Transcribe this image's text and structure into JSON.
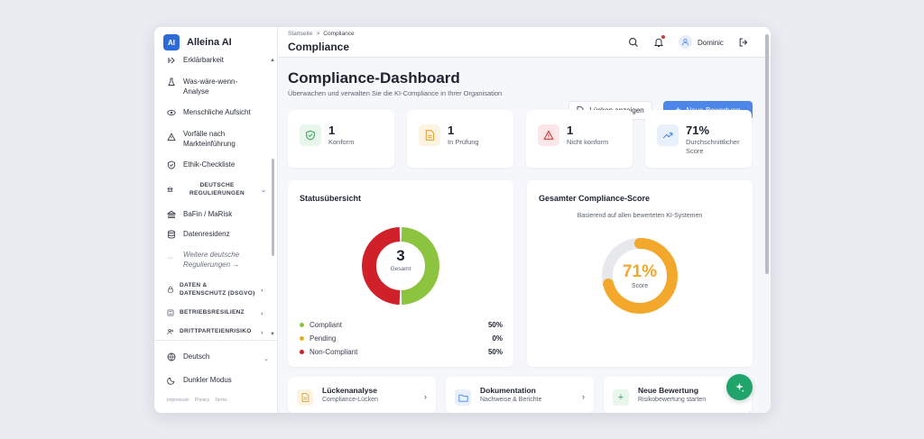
{
  "app": {
    "logo": "AI",
    "name": "Alleina AI"
  },
  "sidebar": {
    "items": [
      {
        "label": "Erklärbarkeit",
        "icon": "explain-icon"
      },
      {
        "label": "Was-wäre-wenn-Analyse",
        "icon": "flask-icon"
      },
      {
        "label": "Menschliche Aufsicht",
        "icon": "eye-icon"
      },
      {
        "label": "Vorfälle nach Markteinführung",
        "icon": "alert-icon"
      },
      {
        "label": "Ethik-Checkliste",
        "icon": "shield-check-icon"
      }
    ],
    "section_de": "DEUTSCHE REGULIERUNGEN",
    "de_items": [
      {
        "label": "BaFin / MaRisk",
        "icon": "bank-icon"
      },
      {
        "label": "Datenresidenz",
        "icon": "database-icon"
      },
      {
        "label": "Weitere deutsche Regulierungen →",
        "icon": "more-icon"
      }
    ],
    "section_data": "DATEN & DATENSCHUTZ (DSGVO)",
    "section_resilience": "BETRIEBSRESILIENZ",
    "section_third": "DRITTPARTEIENRISIKO",
    "language": "Deutsch",
    "dark_mode": "Dunkler Modus",
    "footer": [
      "Impressum",
      "Privacy",
      "Terms"
    ]
  },
  "header": {
    "breadcrumb": [
      "Startseite",
      ">",
      "Compliance"
    ],
    "title": "Compliance",
    "user": "Dominic"
  },
  "page": {
    "title": "Compliance-Dashboard",
    "subtitle": "Überwachen und verwalten Sie die KI-Compliance in Ihrer Organisation",
    "btn_gaps": "Lücken anzeigen",
    "btn_new": "Neue Bewertung"
  },
  "stats": [
    {
      "value": "1",
      "label": "Konform",
      "color": "#3aa55a",
      "bg": "#e9f6ec"
    },
    {
      "value": "1",
      "label": "In Prüfung",
      "color": "#e0a030",
      "bg": "#fdf3e2"
    },
    {
      "value": "1",
      "label": "Nicht konform",
      "color": "#d43b3b",
      "bg": "#fbe7e7"
    },
    {
      "value": "71%",
      "label": "Durchschnittlicher Score",
      "color": "#4c86e8",
      "bg": "#e8f0fc"
    }
  ],
  "status": {
    "title": "Statusübersicht",
    "total": "3",
    "total_label": "Gesamt",
    "legend": [
      {
        "name": "Compliant",
        "pct": "50%",
        "color": "#8cc43f"
      },
      {
        "name": "Pending",
        "pct": "0%",
        "color": "#e6b02e"
      },
      {
        "name": "Non-Compliant",
        "pct": "50%",
        "color": "#d0202a"
      }
    ]
  },
  "score": {
    "title": "Gesamter Compliance-Score",
    "subtitle": "Basierend auf allen bewerteten KI-Systemen",
    "value": "71%",
    "fraction": 0.71,
    "label": "Score",
    "color": "#f3a82c"
  },
  "quick": [
    {
      "title": "Lückenanalyse",
      "sub": "Compliance-Lücken",
      "color": "#e0a030",
      "bg": "#fdf3e2"
    },
    {
      "title": "Dokumentation",
      "sub": "Nachweise & Berichte",
      "color": "#4c86e8",
      "bg": "#e8f0fc"
    },
    {
      "title": "Neue Bewertung",
      "sub": "Risikobewertung starten",
      "color": "#3aa55a",
      "bg": "#e9f6ec"
    }
  ]
}
